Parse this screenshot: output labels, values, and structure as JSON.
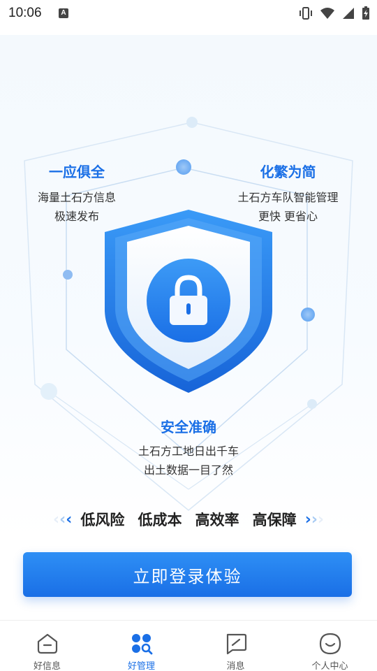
{
  "status_bar": {
    "time": "10:06",
    "notification_icon": "a-icon",
    "icons": [
      "vibrate-icon",
      "wifi-icon",
      "signal-icon",
      "battery-charging-icon"
    ]
  },
  "features": {
    "top_left": {
      "title": "一应俱全",
      "lines": [
        "海量土石方信息",
        "极速发布"
      ]
    },
    "top_right": {
      "title": "化繁为简",
      "lines": [
        "土石方车队智能管理",
        "更快 更省心"
      ]
    },
    "bottom": {
      "title": "安全准确",
      "lines": [
        "土石方工地日出千车",
        "出土数据一目了然"
      ]
    }
  },
  "hero_icons": {
    "shield": "shield-icon",
    "lock": "lock-icon"
  },
  "slogans": [
    "低风险",
    "低成本",
    "高效率",
    "高保障"
  ],
  "slogan_arrows": {
    "left": "double-chevron-left-icon",
    "right": "double-chevron-right-icon"
  },
  "login_button": {
    "label": "立即登录体验"
  },
  "bottom_nav": [
    {
      "label": "好信息",
      "icon": "home-icon",
      "active": false
    },
    {
      "label": "好管理",
      "icon": "manage-search-icon",
      "active": true
    },
    {
      "label": "消息",
      "icon": "message-icon",
      "active": false
    },
    {
      "label": "个人中心",
      "icon": "profile-icon",
      "active": false
    }
  ],
  "colors": {
    "accent": "#1a6fe6",
    "accent_light": "#2e8ff5",
    "text": "#222222",
    "nav_inactive": "#555555"
  }
}
